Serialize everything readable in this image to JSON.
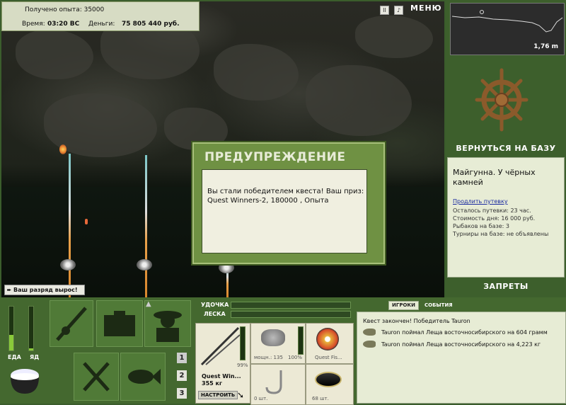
{
  "info": {
    "xp_label": "Получено опыта: 35000",
    "time_label": "Время:",
    "time_value": "03:20 ВС",
    "money_label": "Деньги:",
    "money_value": "75 805 440 руб."
  },
  "topbar": {
    "pause_icon": "pause-icon",
    "sound_icon": "sound-icon",
    "menu_label": "МЕНЮ"
  },
  "depth": {
    "value": "1,76 m"
  },
  "right": {
    "back_to_base": "ВЕРНУТЬСЯ НА БАЗУ",
    "location_name": "Майгунна. У чёрных камней",
    "extend_link": "Продлить путевку",
    "stats": [
      "Осталось путевки: 23 час.",
      "Стоимость дня: 16 000 руб.",
      "Рыбаков на базе: 3",
      "Турниры на базе: не объявлены"
    ],
    "bans": "ЗАПРЕТЫ"
  },
  "dialog": {
    "title": "ПРЕДУПРЕЖДЕНИЕ",
    "message": "Вы стали победителем квеста! Ваш приз: Quest Winners-2, 180000 , Опыта"
  },
  "rank": {
    "text": "Ваш разряд вырос!"
  },
  "status": {
    "food_label": "ЕДА",
    "poison_label": "ЯД",
    "food_level": 0.35,
    "poison_level": 0.05
  },
  "slots": [
    "1",
    "2",
    "3"
  ],
  "tackle": {
    "rod_label": "УДОЧКА",
    "line_label": "ЛЕСКА",
    "rod_pct": "99%",
    "rod_name": "Quest Win...",
    "rod_weight": "355 кг",
    "setup_button": "НАСТРОИТЬ",
    "reel_power": "мощн.: 135",
    "reel_pct": "100%",
    "line_name": "Quest Fis...",
    "hook_count": "0 шт.",
    "bait_count": "68 шт."
  },
  "events": {
    "tab_players": "ИГРОКИ",
    "tab_events": "СОБЫТИЯ",
    "quest_done": "Квест закончен! Победитель Tauron",
    "items": [
      "Tauron поймал Леща восточносибирского на 604 грамм",
      "Tauron поймал Леща восточносибирского на 4,223 кг"
    ]
  },
  "colors": {
    "panel_green": "#3d5f2c",
    "dialog_green": "#6f9143",
    "light_panel": "#e7ecd5"
  }
}
